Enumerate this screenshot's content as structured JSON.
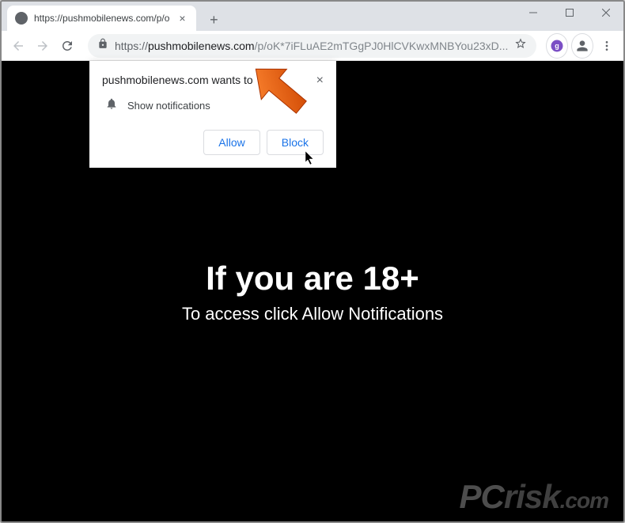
{
  "tab": {
    "title": "https://pushmobilenews.com/p/o"
  },
  "url": {
    "scheme": "https://",
    "domain": "pushmobilenews.com",
    "path": "/p/oK*7iFLuAE2mTGgPJ0HlCVKwxMNBYou23xD..."
  },
  "permission": {
    "title": "pushmobilenews.com wants to",
    "item": "Show notifications",
    "allow": "Allow",
    "block": "Block"
  },
  "page": {
    "heading": "If you are 18+",
    "subtext": "To access click Allow Notifications"
  },
  "watermark": {
    "text": "PCrisk.com"
  },
  "colors": {
    "accent": "#1a73e8",
    "arrow": "#ff6600"
  }
}
